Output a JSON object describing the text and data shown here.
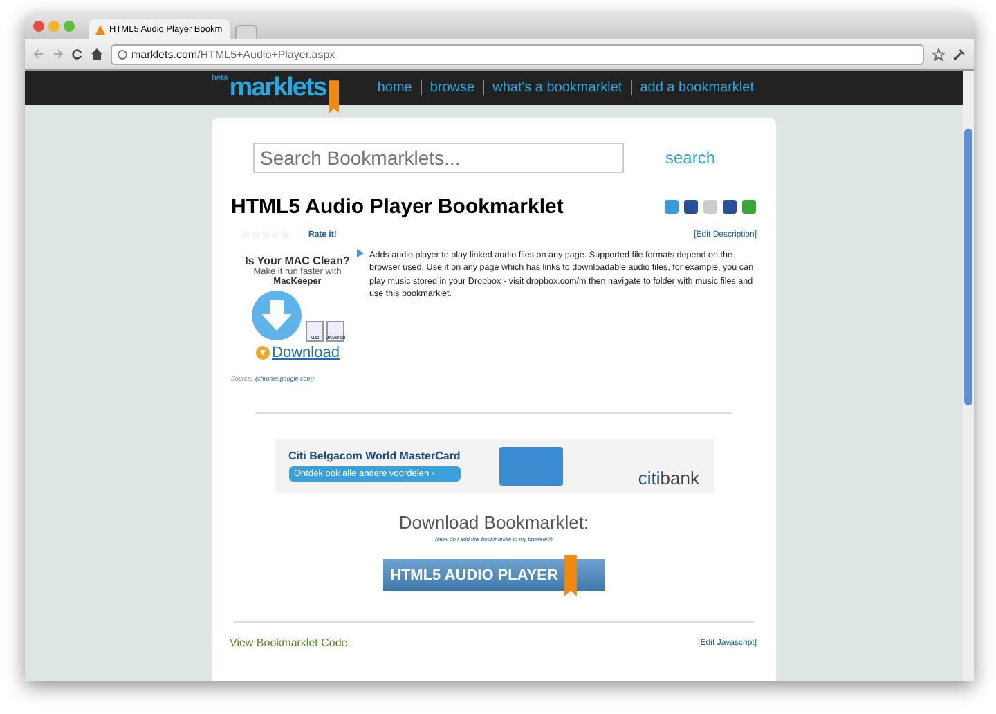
{
  "browser": {
    "tab_title": "HTML5 Audio Player Bookm",
    "url_host": "marklets.com",
    "url_path": "/HTML5+Audio+Player.aspx"
  },
  "site_header": {
    "logo_badge": "beta",
    "logo": "marklets",
    "nav": [
      "home",
      "browse",
      "what's a bookmarklet",
      "add a bookmarklet"
    ]
  },
  "search": {
    "placeholder": "Search Bookmarklets...",
    "button": "search"
  },
  "bookmarklet": {
    "title": "HTML5 Audio Player Bookmarklet",
    "stars": 0,
    "rate_link": "Rate it!",
    "edit_description": "[Edit Description]",
    "description": "Adds audio player to play linked audio files on any page. Supported file formats depend on the browser used. Use it on any page which has links to downloadable audio files, for example, you can play music stored in your Dropbox - visit dropbox.com/m then navigate to folder with music files and use this bookmarklet.",
    "source_label": "Source:",
    "source_link": "(chrome.google.com)"
  },
  "side_ad": {
    "headline": "Is Your MAC Clean?",
    "line_1": "Make it run faster with",
    "line_2": "MacKeeper",
    "icon_label_1": "Mac",
    "icon_label_2": "Universal",
    "download": "Download"
  },
  "banner_ad": {
    "headline": "Citi Belgacom World MasterCard",
    "cta": "Ontdek ook alle andere voordelen ›",
    "brand_1": "citi",
    "brand_2": "bank"
  },
  "download": {
    "heading": "Download Bookmarklet:",
    "help_link": "(How do I add this bookmarklet to my browser?)",
    "button": "HTML5 AUDIO PLAYER"
  },
  "code": {
    "heading": "View Bookmarklet Code:",
    "edit_link": "[Edit Javascript]"
  }
}
